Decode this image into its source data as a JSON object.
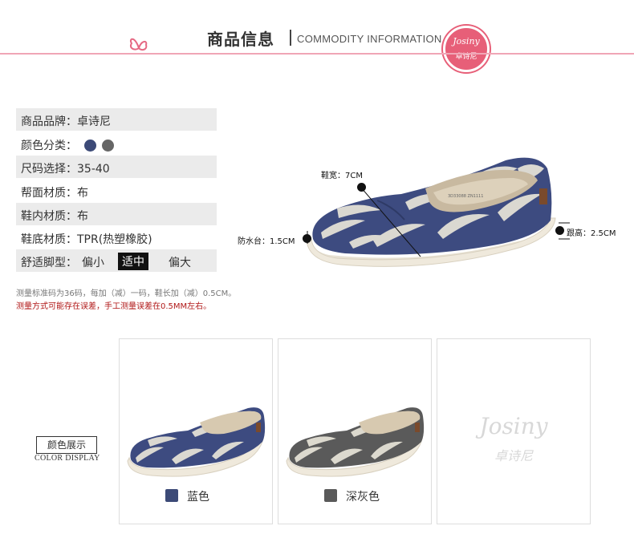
{
  "header": {
    "title": "商品信息",
    "subtitle": "COMMODITY INFORMATION",
    "badge_line1": "Josiny",
    "badge_line2": "卓诗尼"
  },
  "specs": [
    {
      "label": "商品品牌：",
      "value": "卓诗尼"
    },
    {
      "label": "颜色分类：",
      "colors": [
        "#3c4a77",
        "#666666"
      ]
    },
    {
      "label": "尺码选择：",
      "value": "35-40"
    },
    {
      "label": "帮面材质：",
      "value": "布"
    },
    {
      "label": "鞋内材质：",
      "value": "布"
    },
    {
      "label": "鞋底材质：",
      "value": "TPR(热塑橡胶)"
    },
    {
      "label": "舒适脚型：",
      "options": [
        "偏小",
        "适中",
        "偏大"
      ],
      "selected": "适中"
    }
  ],
  "annotations": {
    "width": "鞋宽：7CM",
    "heel": "跟高：2.5CM",
    "platform": "防水台：1.5CM"
  },
  "notes": {
    "line1": "测量标准码为36码，每加（减）一码，鞋长加（减）0.5CM。",
    "line2": "测量方式可能存在误差，手工测量误差在0.5MM左右。"
  },
  "color_display": {
    "title": "颜色展示",
    "subtitle": "COLOR DISPLAY",
    "items": [
      {
        "name": "蓝色",
        "swatch": "#3c4a77"
      },
      {
        "name": "深灰色",
        "swatch": "#5a5a5a"
      }
    ],
    "logo": "Josiny",
    "logo_script": "卓诗尼"
  }
}
